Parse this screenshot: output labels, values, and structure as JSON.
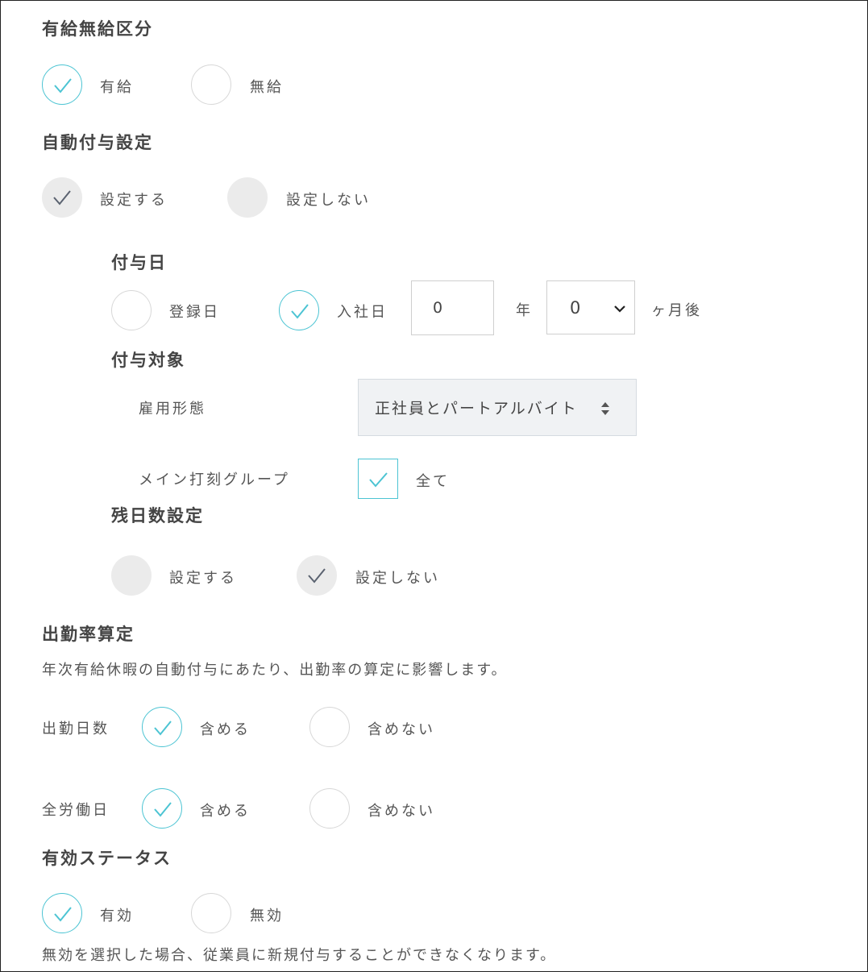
{
  "paid_type": {
    "heading": "有給無給区分",
    "options": [
      "有給",
      "無給"
    ],
    "selected": "有給"
  },
  "auto_grant": {
    "heading": "自動付与設定",
    "options": [
      "設定する",
      "設定しない"
    ],
    "selected": "設定する"
  },
  "grant_date": {
    "heading": "付与日",
    "options": [
      "登録日",
      "入社日"
    ],
    "selected": "入社日",
    "year_value": "0",
    "year_unit": "年",
    "month_value": "0",
    "month_unit": "ヶ月後"
  },
  "grant_target": {
    "heading": "付与対象",
    "employment_label": "雇用形態",
    "employment_value": "正社員とパートアルバイト",
    "group_label": "メイン打刻グループ",
    "group_all_label": "全て",
    "group_all_checked": true
  },
  "remaining_days": {
    "heading": "残日数設定",
    "options": [
      "設定する",
      "設定しない"
    ],
    "selected": "設定しない"
  },
  "attendance_rate": {
    "heading": "出勤率算定",
    "description": "年次有給休暇の自動付与にあたり、出勤率の算定に影響します。",
    "rows": [
      {
        "label": "出勤日数",
        "options": [
          "含める",
          "含めない"
        ],
        "selected": "含める"
      },
      {
        "label": "全労働日",
        "options": [
          "含める",
          "含めない"
        ],
        "selected": "含める"
      }
    ]
  },
  "status": {
    "heading": "有効ステータス",
    "options": [
      "有効",
      "無効"
    ],
    "selected": "有効",
    "note": "無効を選択した場合、従業員に新規付与することができなくなります。"
  },
  "colors": {
    "accent": "#4cc4d3",
    "gray_fill": "#ebebeb",
    "dark_check": "#5a6270"
  }
}
